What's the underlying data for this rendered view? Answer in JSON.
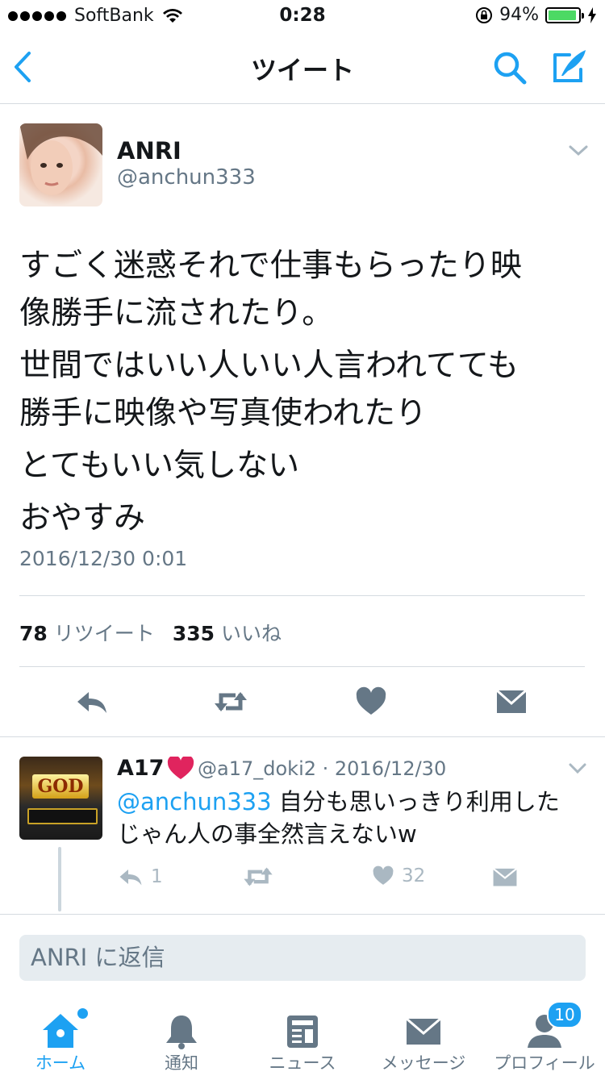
{
  "status_bar": {
    "carrier": "SoftBank",
    "time": "0:28",
    "battery": "94%",
    "battery_level": 0.94
  },
  "nav": {
    "title": "ツイート",
    "icons": [
      "back-chevron-icon",
      "search-icon",
      "compose-icon"
    ]
  },
  "tweet": {
    "name": "ANRI",
    "handle": "@anchun333",
    "text_lines": [
      "すごく迷惑それで仕事もらったり映",
      "像勝手に流されたり。",
      "世間ではいい人いい人言われてても",
      "勝手に映像や写真使われたり",
      "とてもいい気しない",
      "おやすみ"
    ],
    "timestamp": "2016/12/30 0:01",
    "retweet_count": "78",
    "retweet_label": "リツイート",
    "like_count": "335",
    "like_label": "いいね"
  },
  "reply": {
    "name": "A17",
    "handle_date": "@a17_doki2 · 2016/12/30",
    "mention": "@anchun333",
    "text_1": " 自分も思いっきり利用した",
    "text_2": "じゃん人の事全然言えないw",
    "reply_count": "1",
    "like_count": "32",
    "avatar_text": "GOD"
  },
  "reply_box": {
    "placeholder": "ANRI に返信"
  },
  "tabs": [
    {
      "label": "ホーム",
      "icon": "home-icon",
      "active": true
    },
    {
      "label": "通知",
      "icon": "bell-icon"
    },
    {
      "label": "ニュース",
      "icon": "news-icon"
    },
    {
      "label": "メッセージ",
      "icon": "envelope-icon"
    },
    {
      "label": "プロフィール",
      "icon": "profile-icon",
      "badge": "10"
    }
  ],
  "colors": {
    "accent": "#1da1f2",
    "secondary_text": "#657786",
    "heart": "#e0245e"
  }
}
